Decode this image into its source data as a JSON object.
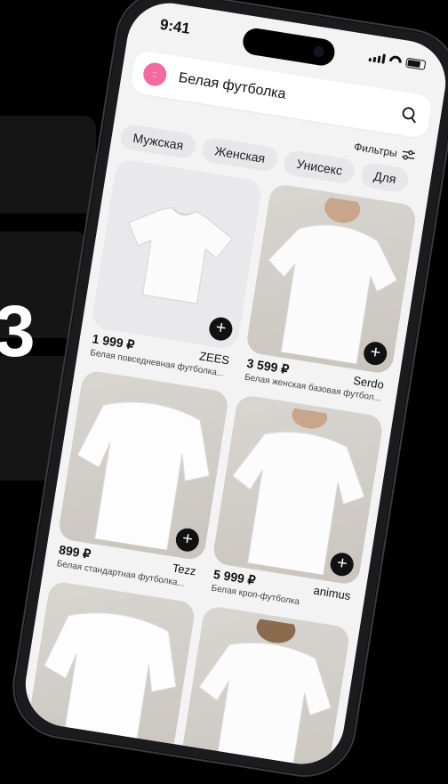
{
  "status": {
    "time": "9:41"
  },
  "search": {
    "query": "Белая футболка",
    "logo_glyph": "::"
  },
  "filters": {
    "label": "Фильтры"
  },
  "chips": [
    "Мужская",
    "Женская",
    "Унисекс",
    "Для"
  ],
  "products": [
    {
      "price": "1 999 ₽",
      "brand": "ZEES",
      "desc": "Белая повседневная футболка...",
      "image": "flat-tshirt",
      "add": "+"
    },
    {
      "price": "3 599 ₽",
      "brand": "Serdo",
      "desc": "Белая женская базовая футбол...",
      "image": "person-tshirt",
      "add": "+"
    },
    {
      "price": "899 ₽",
      "brand": "Tezz",
      "desc": "Белая стандартная футболка...",
      "image": "person-tshirt",
      "add": "+"
    },
    {
      "price": "5 999 ₽",
      "brand": "animus",
      "desc": "Белая кроп-футболка",
      "image": "person-tshirt",
      "add": "+"
    },
    {
      "price": "",
      "brand": "",
      "desc": "",
      "image": "person-tshirt",
      "add": ""
    },
    {
      "price": "",
      "brand": "",
      "desc": "",
      "image": "person-tshirt",
      "add": ""
    }
  ],
  "background": {
    "digit": "3"
  },
  "colors": {
    "logo": "#f26aa0",
    "add_button": "#111111",
    "screen_bg": "#f3f3f4"
  }
}
